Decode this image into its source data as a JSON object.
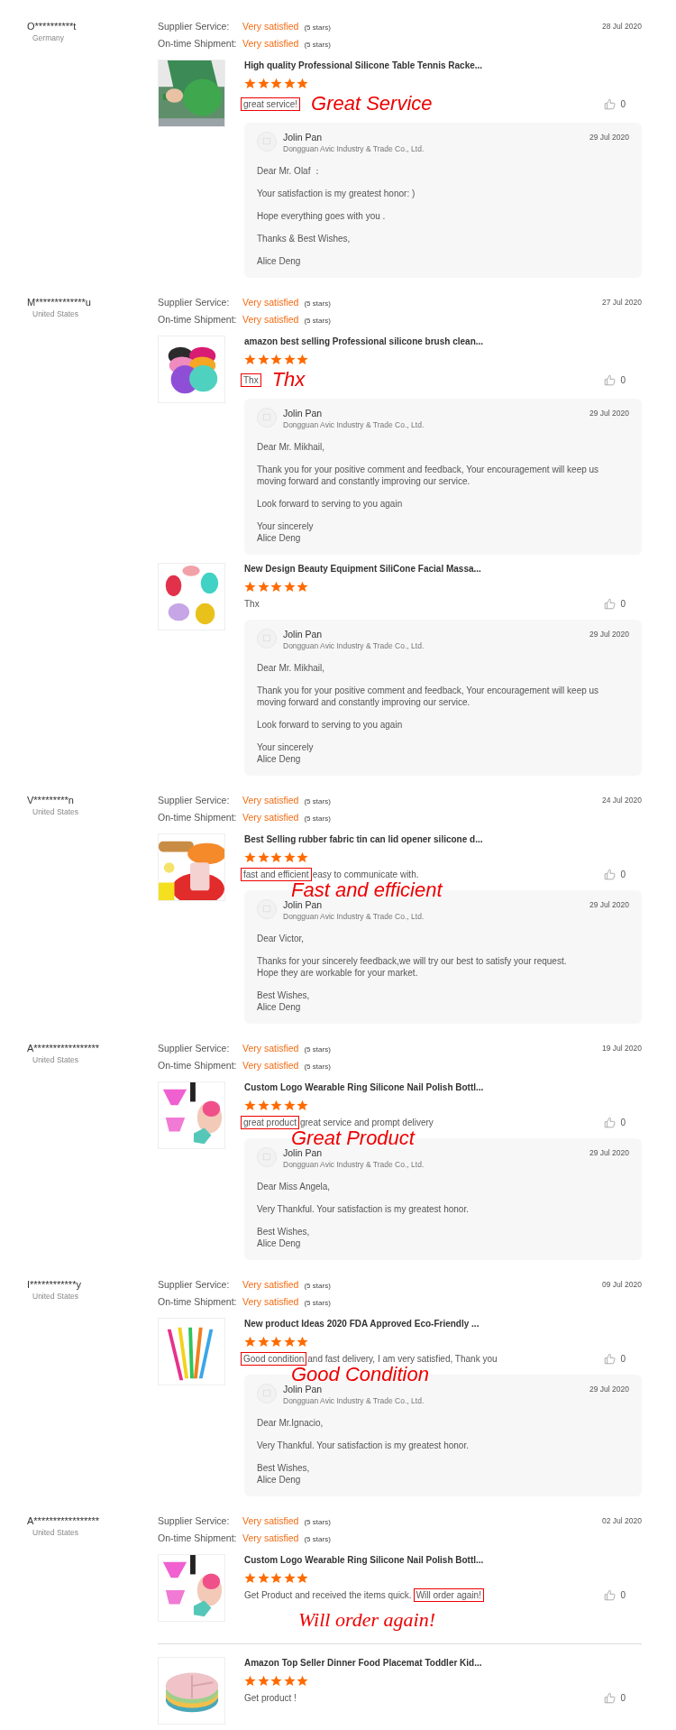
{
  "reviews": [
    {
      "user": "O**********t",
      "country": "Germany",
      "date": "28 Jul 2020",
      "ratings": [
        {
          "label": "Supplier Service:",
          "value": "Very satisfied",
          "note": "(5 stars)"
        },
        {
          "label": "On-time Shipment:",
          "value": "Very satisfied",
          "note": "(5 stars)"
        }
      ],
      "products": [
        {
          "kind": "picture",
          "title": "High quality Professional Silicone Table Tennis Racke...",
          "stars": 5,
          "comment": [
            {
              "text": "great service!",
              "boxed": true
            }
          ],
          "annotation": "Great Service",
          "likes": "0",
          "divider_above": false,
          "reply": {
            "name": "Jolin Pan",
            "company": "Dongguan Avic Industry & Trade Co., Ltd.",
            "date": "29 Jul 2020",
            "paragraphs": [
              [
                "Dear Mr. Olaf ："
              ],
              [
                "Your satisfaction is my greatest honor:  )"
              ],
              [
                "Hope everything goes with you ."
              ],
              [
                "Thanks & Best Wishes,"
              ],
              [
                "Alice Deng"
              ]
            ]
          }
        }
      ]
    },
    {
      "user": "M*************u",
      "country": "United States",
      "date": "27 Jul 2020",
      "ratings": [
        {
          "label": "Supplier Service:",
          "value": "Very satisfied",
          "note": "(5 stars)"
        },
        {
          "label": "On-time Shipment:",
          "value": "Very satisfied",
          "note": "(5 stars)"
        }
      ],
      "products": [
        {
          "kind": "picture",
          "title": "amazon best selling Professional silicone brush clean...",
          "stars": 5,
          "comment": [
            {
              "text": "Thx",
              "boxed": true
            }
          ],
          "annotation": "Thx",
          "likes": "0",
          "divider_above": false,
          "reply": {
            "name": "Jolin Pan",
            "company": "Dongguan Avic Industry & Trade Co., Ltd.",
            "date": "29 Jul 2020",
            "paragraphs": [
              [
                "Dear Mr. Mikhail,"
              ],
              [
                "Thank you for your positive comment and feedback, Your encouragement will keep us moving forward and constantly improving our service."
              ],
              [
                "Look forward to serving to you again"
              ],
              [
                "Your sincerely",
                "Alice Deng"
              ]
            ]
          }
        },
        {
          "kind": "picture",
          "title": "New Design Beauty Equipment SiliCone Facial Massa...",
          "stars": 5,
          "comment": [
            {
              "text": "Thx",
              "boxed": false
            }
          ],
          "likes": "0",
          "divider_above": false,
          "reply": {
            "name": "Jolin Pan",
            "company": "Dongguan Avic Industry & Trade Co., Ltd.",
            "date": "29 Jul 2020",
            "paragraphs": [
              [
                "Dear Mr. Mikhail,"
              ],
              [
                "Thank you for your positive comment and feedback, Your encouragement will keep us moving forward and constantly improving our service."
              ],
              [
                "Look forward to serving to you again"
              ],
              [
                "Your sincerely",
                "Alice Deng"
              ]
            ]
          }
        }
      ]
    },
    {
      "user": "V*********n",
      "country": "United States",
      "date": "24 Jul 2020",
      "ratings": [
        {
          "label": "Supplier Service:",
          "value": "Very satisfied",
          "note": "(5 stars)"
        },
        {
          "label": "On-time Shipment:",
          "value": "Very satisfied",
          "note": "(5 stars)"
        }
      ],
      "products": [
        {
          "kind": "picture",
          "title": "Best Selling rubber fabric tin can lid opener silicone d...",
          "stars": 5,
          "comment": [
            {
              "text": "fast and efficient",
              "boxed": true
            },
            {
              "text": "easy to communicate with.",
              "boxed": false
            }
          ],
          "annotation": "Fast and efficient",
          "likes": "0",
          "divider_above": false,
          "reply": {
            "name": "Jolin Pan",
            "company": "Dongguan Avic Industry & Trade Co., Ltd.",
            "date": "29 Jul 2020",
            "paragraphs": [
              [
                "Dear Victor,"
              ],
              [
                "Thanks for your sincerely feedback,we will try our best  to satisfy your request.",
                "Hope they are workable for your market."
              ],
              [
                "Best Wishes,",
                "Alice Deng"
              ]
            ]
          }
        }
      ]
    },
    {
      "user": "A*****************",
      "country": "United States",
      "date": "19 Jul 2020",
      "ratings": [
        {
          "label": "Supplier Service:",
          "value": "Very satisfied",
          "note": "(5 stars)"
        },
        {
          "label": "On-time Shipment:",
          "value": "Very satisfied",
          "note": "(5 stars)"
        }
      ],
      "products": [
        {
          "kind": "picture",
          "title": "Custom Logo Wearable Ring Silicone Nail Polish Bottl...",
          "stars": 5,
          "comment": [
            {
              "text": "great product",
              "boxed": true
            },
            {
              "text": "great service and prompt delivery",
              "boxed": false
            }
          ],
          "annotation": "Great Product",
          "likes": "0",
          "divider_above": false,
          "reply": {
            "name": "Jolin Pan",
            "company": "Dongguan Avic Industry & Trade Co., Ltd.",
            "date": "29 Jul 2020",
            "paragraphs": [
              [
                "Dear Miss Angela,"
              ],
              [
                "Very Thankful. Your satisfaction is my greatest honor."
              ],
              [
                "Best Wishes,",
                "Alice Deng"
              ]
            ]
          }
        }
      ]
    },
    {
      "user": "I************y",
      "country": "United States",
      "date": "09 Jul 2020",
      "ratings": [
        {
          "label": "Supplier Service:",
          "value": "Very satisfied",
          "note": "(5 stars)"
        },
        {
          "label": "On-time Shipment:",
          "value": "Very satisfied",
          "note": "(5 stars)"
        }
      ],
      "products": [
        {
          "kind": "picture",
          "title": "New product Ideas 2020 FDA Approved Eco-Friendly ...",
          "stars": 5,
          "comment": [
            {
              "text": "Good condition",
              "boxed": true
            },
            {
              "text": "and fast delivery, I am very satisfied, Thank you",
              "boxed": false
            }
          ],
          "annotation": "Good Condition",
          "likes": "0",
          "divider_above": false,
          "reply": {
            "name": "Jolin Pan",
            "company": "Dongguan Avic Industry & Trade Co., Ltd.",
            "date": "29 Jul 2020",
            "paragraphs": [
              [
                "Dear Mr.Ignacio,"
              ],
              [
                "Very Thankful. Your satisfaction is my greatest honor."
              ],
              [
                "Best Wishes,",
                "Alice Deng"
              ]
            ]
          }
        }
      ]
    },
    {
      "user": "A*****************",
      "country": "United States",
      "date": "02 Jul 2020",
      "ratings": [
        {
          "label": "Supplier Service:",
          "value": "Very satisfied",
          "note": "(5 stars)"
        },
        {
          "label": "On-time Shipment:",
          "value": "Very satisfied",
          "note": "(5 stars)"
        }
      ],
      "products": [
        {
          "kind": "picture",
          "title": "Custom Logo Wearable Ring Silicone Nail Polish Bottl...",
          "stars": 5,
          "comment": [
            {
              "text": "Get Product and received the items quick.",
              "boxed": false
            },
            {
              "text": "Will order again!",
              "boxed": true
            }
          ],
          "annotation": "Will order again!",
          "likes": "0",
          "divider_above": false
        },
        {
          "kind": "picture",
          "title": "Amazon Top Seller Dinner Food Placemat Toddler Kid...",
          "stars": 5,
          "comment": [
            {
              "text": "Get product !",
              "boxed": false
            }
          ],
          "likes": "0",
          "divider_above": true
        }
      ]
    }
  ]
}
